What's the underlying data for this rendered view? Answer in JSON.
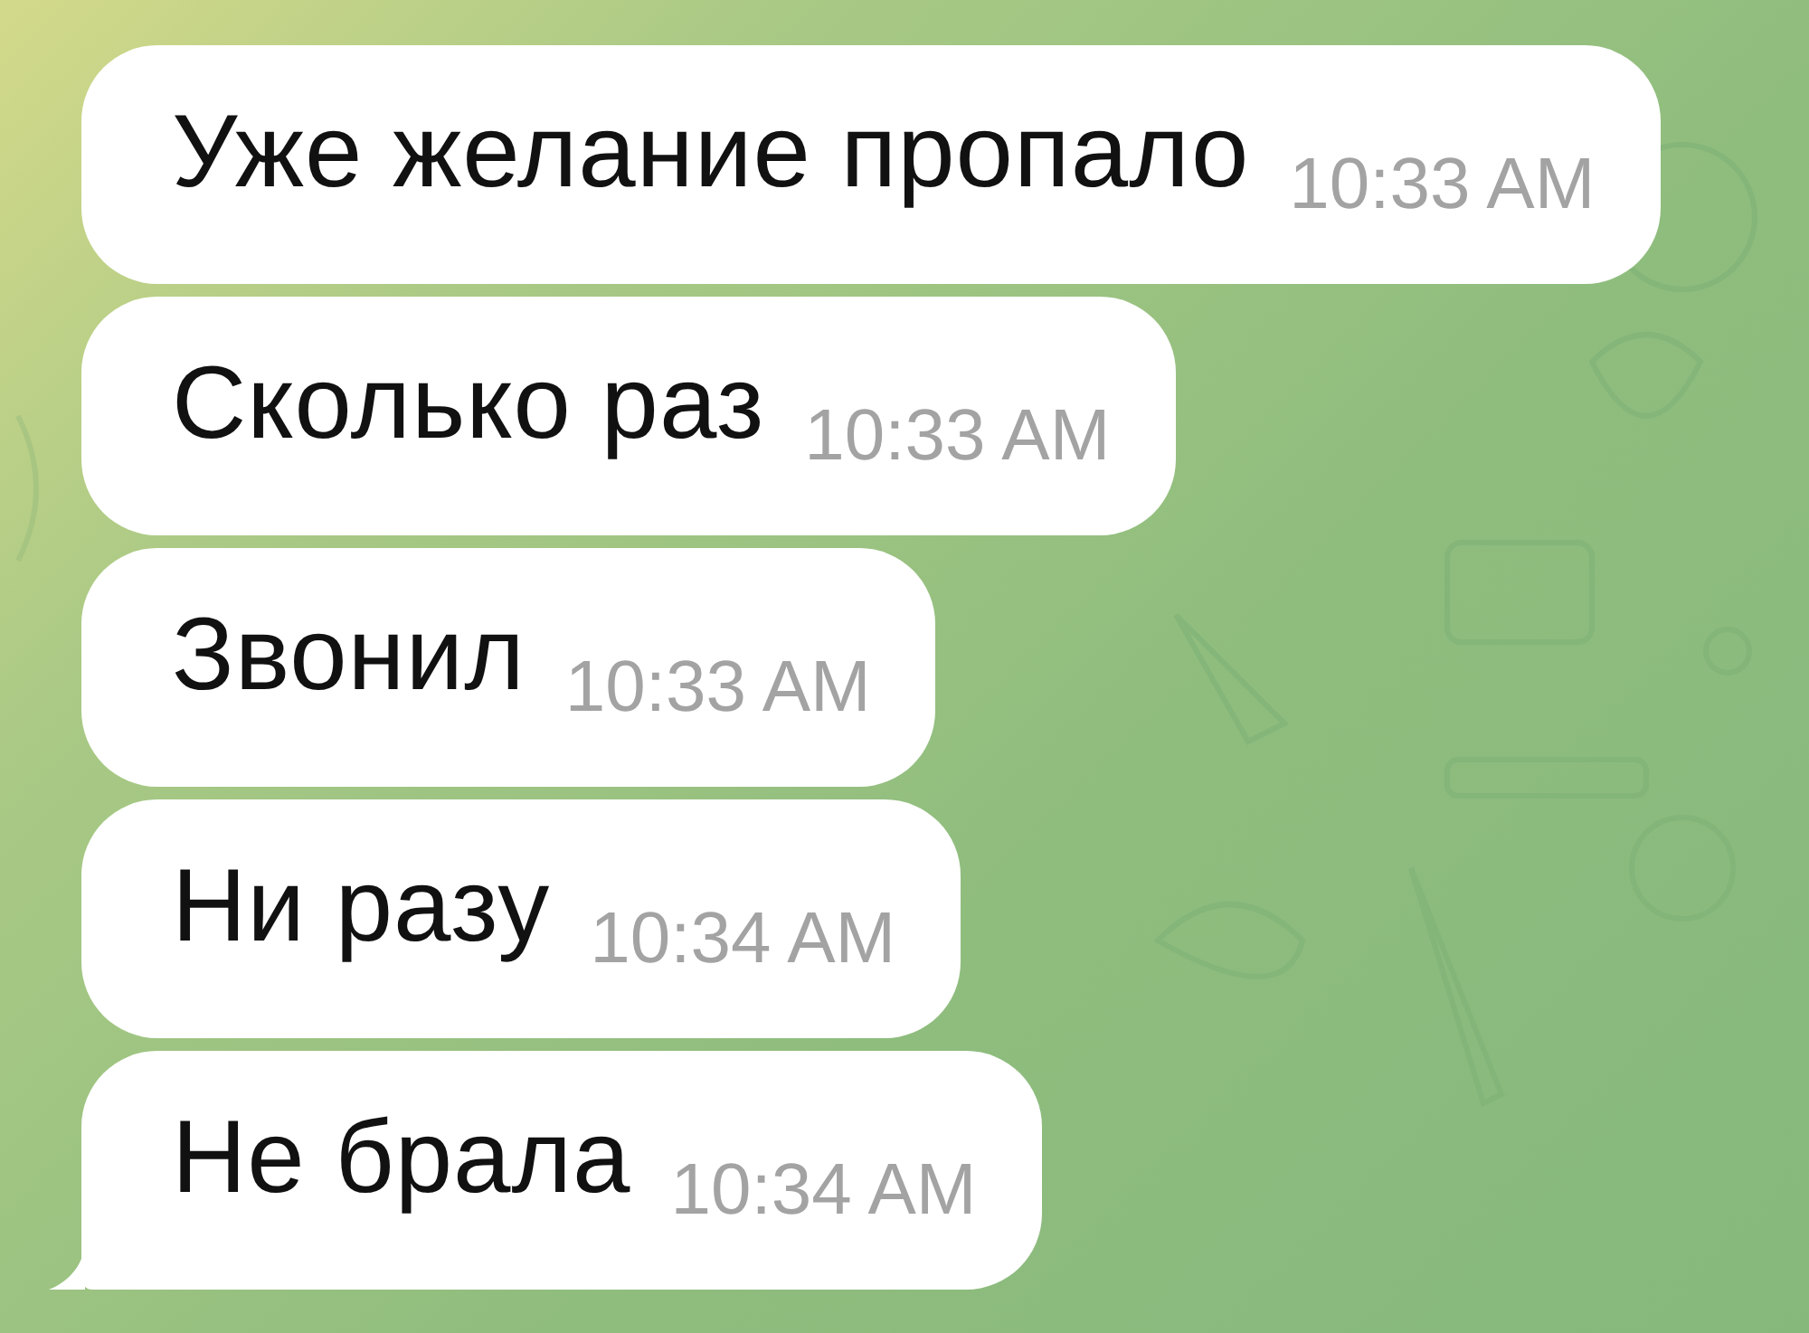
{
  "messages": [
    {
      "text": "Уже желание пропало",
      "time": "10:33 AM",
      "tail": false
    },
    {
      "text": "Сколько раз",
      "time": "10:33 AM",
      "tail": false
    },
    {
      "text": "Звонил",
      "time": "10:33 AM",
      "tail": false
    },
    {
      "text": "Ни разу",
      "time": "10:34 AM",
      "tail": false
    },
    {
      "text": "Не брала",
      "time": "10:34 AM",
      "tail": true
    }
  ]
}
